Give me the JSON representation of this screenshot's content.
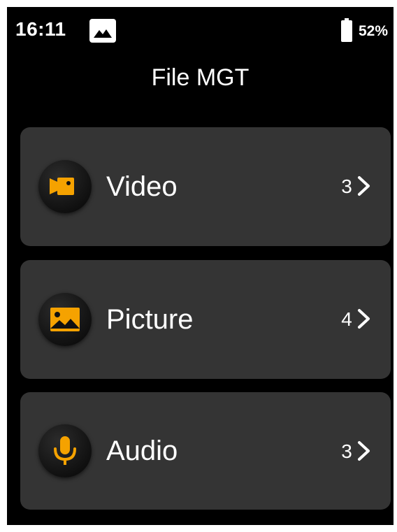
{
  "status_bar": {
    "time": "16:11",
    "notification_icon": "image-notification-icon",
    "battery_icon": "battery-icon",
    "battery_percent": "52%"
  },
  "header": {
    "title": "File MGT"
  },
  "categories": [
    {
      "label": "Video",
      "count": "3",
      "icon": "video-camera-icon"
    },
    {
      "label": "Picture",
      "count": "4",
      "icon": "picture-icon"
    },
    {
      "label": "Audio",
      "count": "3",
      "icon": "microphone-icon"
    }
  ],
  "colors": {
    "background": "#000000",
    "card": "#343434",
    "accent": "#F5A200",
    "text": "#FFFFFF"
  }
}
